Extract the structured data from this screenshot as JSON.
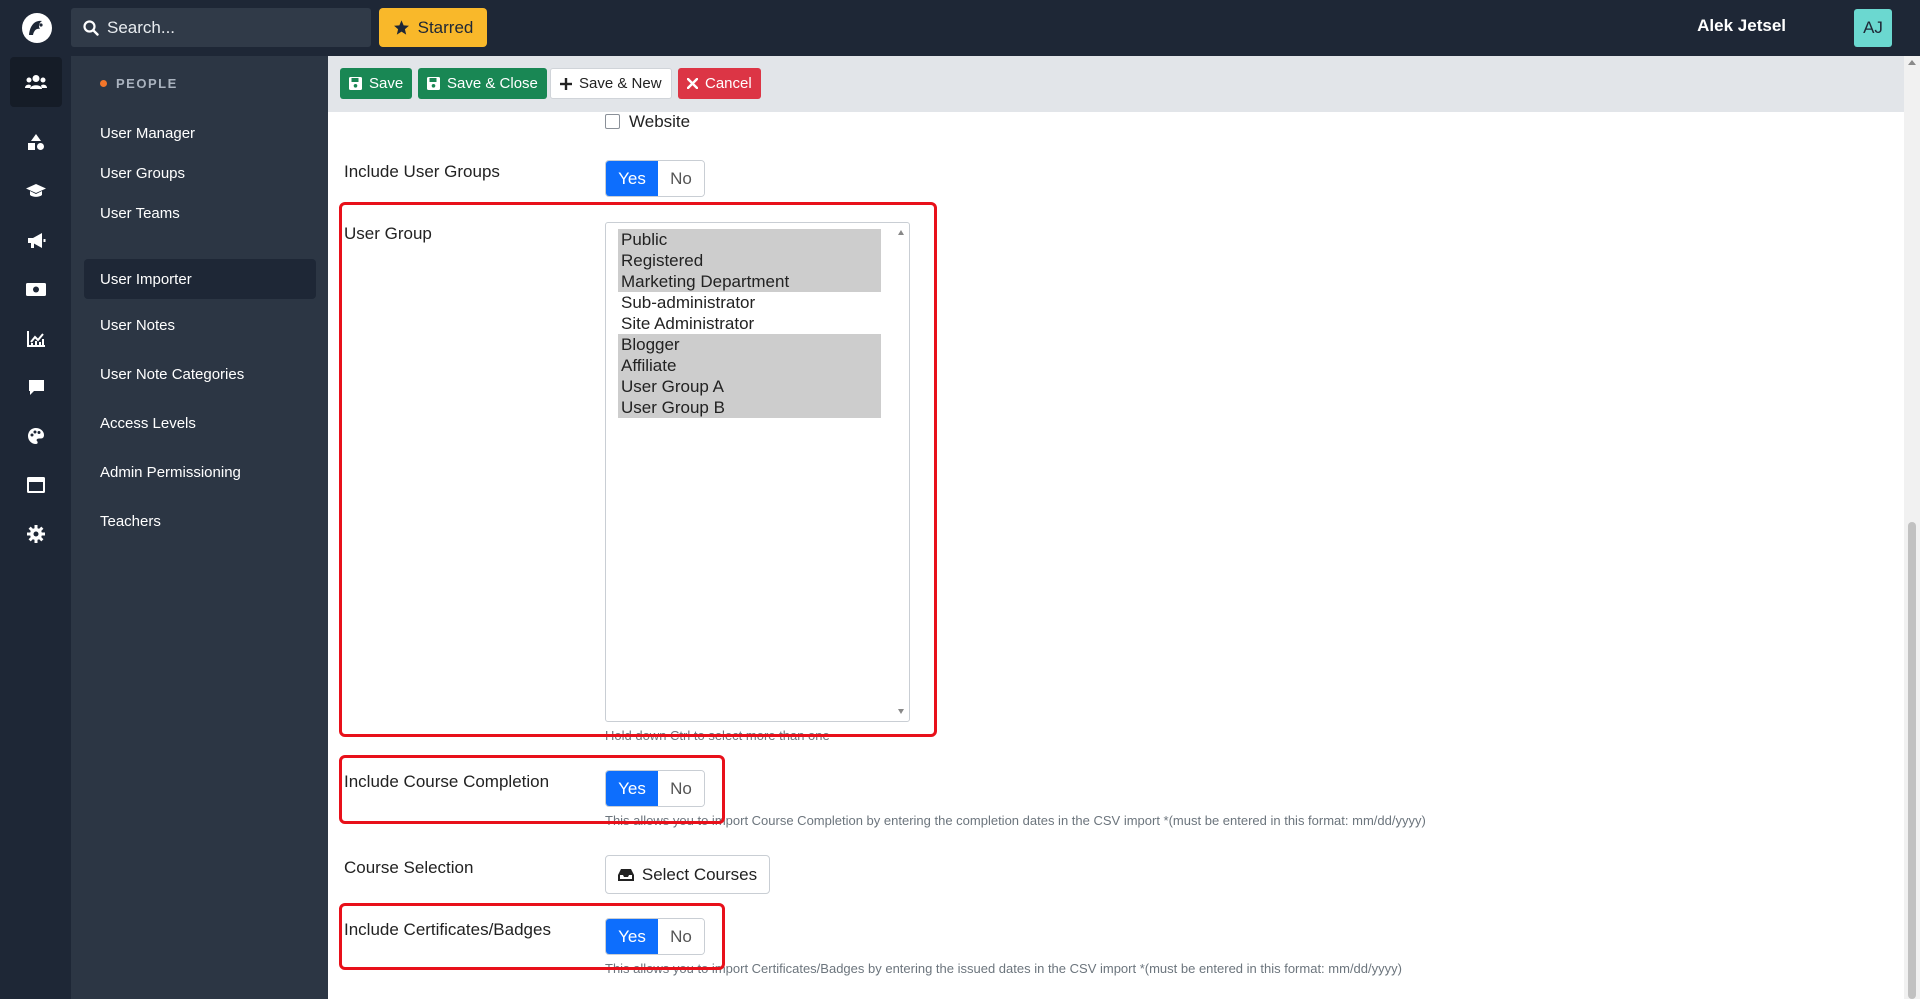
{
  "header": {
    "search_placeholder": "Search...",
    "starred_label": "Starred",
    "user_name": "Alek Jetsel",
    "avatar_initials": "AJ"
  },
  "rail": {
    "icons": [
      "people-icon",
      "shapes-icon",
      "graduation-cap-icon",
      "megaphone-icon",
      "money-icon",
      "chart-icon",
      "comment-icon",
      "palette-icon",
      "window-icon",
      "gear-icon"
    ]
  },
  "sidebar": {
    "heading": "PEOPLE",
    "items": [
      {
        "label": "User Manager"
      },
      {
        "label": "User Groups"
      },
      {
        "label": "User Teams"
      },
      {
        "label": "User Importer"
      },
      {
        "label": "User Notes"
      },
      {
        "label": "User Note Categories"
      },
      {
        "label": "Access Levels"
      },
      {
        "label": "Admin Permissioning"
      },
      {
        "label": "Teachers"
      }
    ],
    "active": "User Importer"
  },
  "toolbar": {
    "save_label": "Save",
    "save_close_label": "Save & Close",
    "save_new_label": "Save & New",
    "cancel_label": "Cancel"
  },
  "form": {
    "website_label": "Website",
    "include_user_groups_label": "Include User Groups",
    "user_group_label": "User Group",
    "user_group_options": [
      {
        "label": "Public",
        "selected": true
      },
      {
        "label": "Registered",
        "selected": true
      },
      {
        "label": "Marketing Department",
        "selected": true
      },
      {
        "label": "Sub-administrator",
        "selected": false
      },
      {
        "label": "Site Administrator",
        "selected": false
      },
      {
        "label": "Blogger",
        "selected": true
      },
      {
        "label": "Affiliate",
        "selected": true
      },
      {
        "label": "User Group A",
        "selected": true
      },
      {
        "label": "User Group B",
        "selected": true
      }
    ],
    "user_group_help": "Hold down Ctrl to select more than one",
    "include_course_completion_label": "Include Course Completion",
    "course_completion_help": "This allows you to import Course Completion by entering the completion dates in the CSV import *(must be entered in this format: mm/dd/yyyy)",
    "course_selection_label": "Course Selection",
    "select_courses_label": "Select Courses",
    "include_certificates_label": "Include Certificates/Badges",
    "certificates_help": "This allows you to import Certificates/Badges by entering the issued dates in the CSV import *(must be entered in this format: mm/dd/yyyy)",
    "yes_label": "Yes",
    "no_label": "No"
  },
  "colors": {
    "topbar": "#1e2736",
    "sidebar": "#2c3644",
    "accent_yes": "#0d6efd",
    "save_green": "#198754",
    "cancel_red": "#dc3545",
    "starred_yellow": "#f9b82a",
    "highlight_red": "#e8101a"
  }
}
